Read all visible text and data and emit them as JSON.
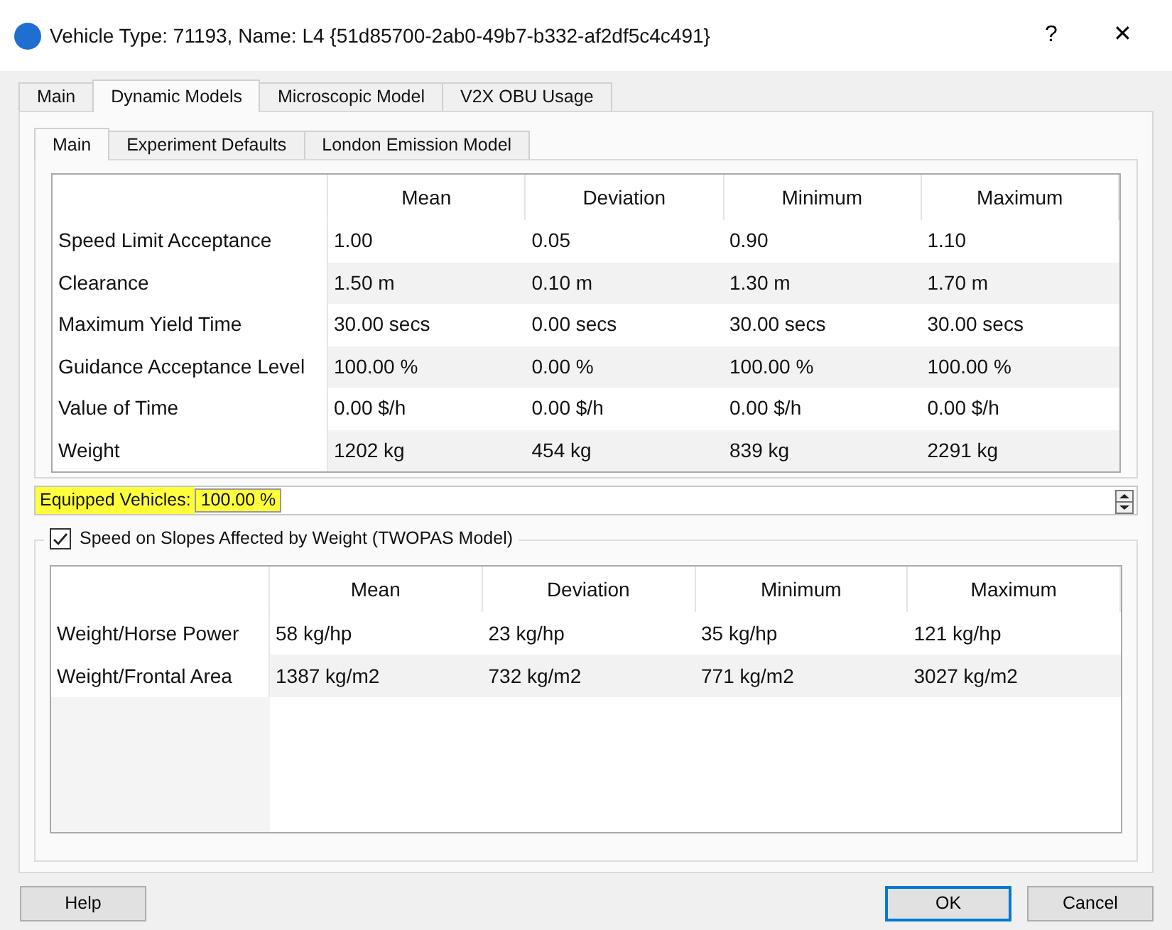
{
  "window": {
    "title": "Vehicle Type: 71193, Name: L4  {51d85700-2ab0-49b7-b332-af2df5c4c491}",
    "help": "?",
    "close": "✕"
  },
  "tabs": [
    {
      "label": "Main",
      "selected": false
    },
    {
      "label": "Dynamic Models",
      "selected": true
    },
    {
      "label": "Microscopic Model",
      "selected": false
    },
    {
      "label": "V2X OBU Usage",
      "selected": false
    }
  ],
  "subtabs": [
    {
      "label": "Main",
      "selected": true
    },
    {
      "label": "Experiment Defaults",
      "selected": false
    },
    {
      "label": "London Emission Model",
      "selected": false
    }
  ],
  "table": {
    "columns": [
      "Mean",
      "Deviation",
      "Minimum",
      "Maximum"
    ],
    "rows": [
      {
        "label": "Speed Limit Acceptance",
        "cells": [
          "1.00",
          "0.05",
          "0.90",
          "1.10"
        ]
      },
      {
        "label": "Clearance",
        "cells": [
          "1.50 m",
          "0.10 m",
          "1.30 m",
          "1.70 m"
        ]
      },
      {
        "label": "Maximum Yield Time",
        "cells": [
          "30.00 secs",
          "0.00 secs",
          "30.00 secs",
          "30.00 secs"
        ]
      },
      {
        "label": "Guidance Acceptance Level",
        "cells": [
          "100.00 %",
          "0.00 %",
          "100.00 %",
          "100.00 %"
        ]
      },
      {
        "label": "Value of Time",
        "cells": [
          "0.00 $/h",
          "0.00 $/h",
          "0.00 $/h",
          "0.00 $/h"
        ]
      },
      {
        "label": "Weight",
        "cells": [
          "1202 kg",
          "454 kg",
          "839 kg",
          "2291 kg"
        ]
      }
    ]
  },
  "equipped": {
    "label": "Equipped Vehicles:",
    "value": "100.00 %"
  },
  "slopes": {
    "label": "Speed on Slopes Affected by Weight (TWOPAS Model)",
    "checked": true,
    "table": {
      "columns": [
        "Mean",
        "Deviation",
        "Minimum",
        "Maximum"
      ],
      "rows": [
        {
          "label": "Weight/Horse Power",
          "cells": [
            "58 kg/hp",
            "23 kg/hp",
            "35 kg/hp",
            "121 kg/hp"
          ]
        },
        {
          "label": "Weight/Frontal Area",
          "cells": [
            "1387 kg/m2",
            "732 kg/m2",
            "771 kg/m2",
            "3027 kg/m2"
          ]
        }
      ]
    }
  },
  "buttons": [
    {
      "label": "Help",
      "kind": "left",
      "default": false
    },
    {
      "label": "OK",
      "kind": "right",
      "default": true
    },
    {
      "label": "Cancel",
      "kind": "right",
      "default": false
    }
  ]
}
